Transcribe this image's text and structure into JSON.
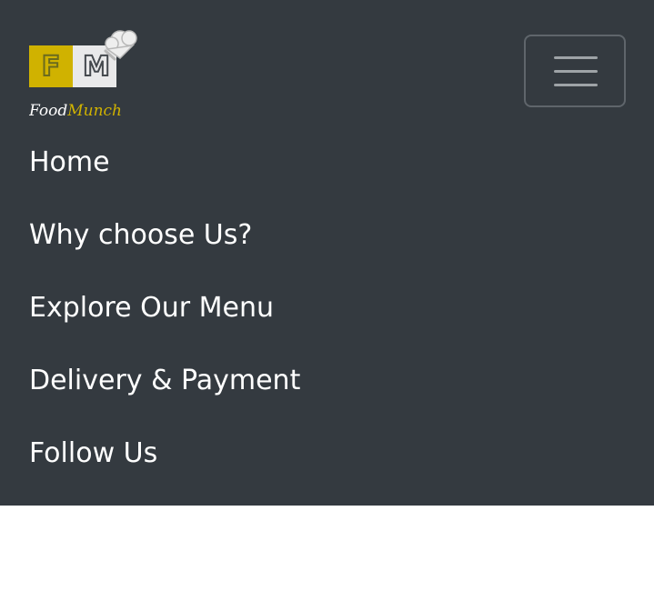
{
  "brand": {
    "logo_letter_left": "F",
    "logo_letter_right": "M",
    "wordmark_part1": "Food",
    "wordmark_part2": "Munch",
    "accent_color": "#d0b200"
  },
  "toggler": {
    "icon": "hamburger-menu-icon"
  },
  "nav": {
    "items": [
      {
        "label": "Home"
      },
      {
        "label": "Why choose Us?"
      },
      {
        "label": "Explore Our Menu"
      },
      {
        "label": "Delivery & Payment"
      },
      {
        "label": "Follow Us"
      }
    ]
  },
  "colors": {
    "navbar_bg": "#343a40",
    "nav_text": "#ffffff",
    "page_bg": "#ffffff"
  }
}
